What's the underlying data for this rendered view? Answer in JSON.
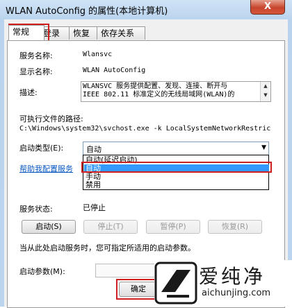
{
  "window": {
    "title": "WLAN AutoConfig 的属性(本地计算机)",
    "close_symbol": "X"
  },
  "tabs": [
    {
      "label": "常规",
      "active": true
    },
    {
      "label": "登录",
      "active": false
    },
    {
      "label": "恢复",
      "active": false
    },
    {
      "label": "依存关系",
      "active": false
    }
  ],
  "general": {
    "service_name_label": "服务名称:",
    "service_name_value": "Wlansvc",
    "display_name_label": "显示名称:",
    "display_name_value": "WLAN AutoConfig",
    "description_label": "描述:",
    "description_lines": [
      "WLANSVC 服务提供配置、发现、连接、断开与",
      "IEEE 802.11 标准定义的无线局域网(WLAN)的"
    ],
    "path_label": "可执行文件的路径:",
    "path_value": "C:\\Windows\\system32\\svchost.exe -k LocalSystemNetworkRestric",
    "startup_type_label": "启动类型(E):",
    "startup_type_value": "自动",
    "startup_options": [
      "自动(延迟启动)",
      "自动",
      "手动",
      "禁用"
    ],
    "selected_option_index": 1,
    "help_link": "帮助我配置服务",
    "status_label": "服务状态:",
    "status_value": "已停止",
    "buttons": {
      "start": "启动(S)",
      "stop": "停止(T)",
      "pause": "暂停(P)",
      "resume": "恢复(R)"
    },
    "hint": "当从此处启动服务时，您可指定所适用的启动参数。",
    "params_label": "启动参数(M):",
    "params_value": ""
  },
  "footer": {
    "ok_label": "确定"
  },
  "watermark": {
    "text": "爱纯净",
    "url": "aichunjing.com"
  },
  "colors": {
    "highlight_box": "#d11f1f",
    "selection": "#3399ff",
    "link": "#0a58c4"
  }
}
